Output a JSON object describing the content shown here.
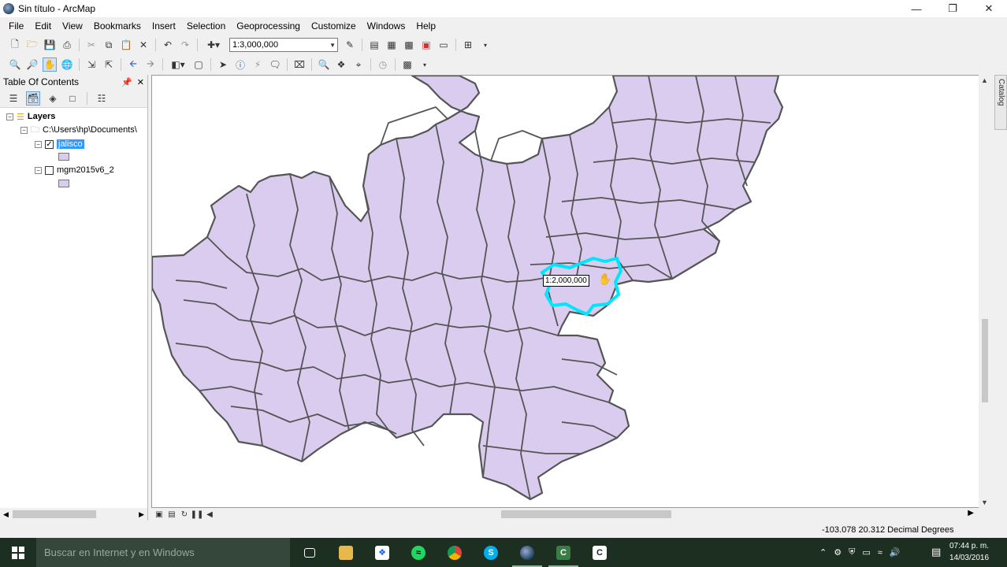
{
  "window": {
    "title": "Sin título - ArcMap",
    "controls": [
      "minimize",
      "restore",
      "close"
    ]
  },
  "menu": [
    "File",
    "Edit",
    "View",
    "Bookmarks",
    "Insert",
    "Selection",
    "Geoprocessing",
    "Customize",
    "Windows",
    "Help"
  ],
  "toolbar": {
    "scale_value": "1:3,000,000",
    "standard_icons": [
      "new-document-icon",
      "open-icon",
      "save-icon",
      "print-icon",
      "cut-icon",
      "copy-icon",
      "paste-icon",
      "delete-icon",
      "undo-icon",
      "redo-icon",
      "add-data-icon"
    ],
    "tools_icons": [
      "zoom-in-icon",
      "zoom-out-icon",
      "pan-icon",
      "full-extent-icon",
      "fixed-zoom-in-icon",
      "fixed-zoom-out-icon",
      "back-extent-icon",
      "forward-extent-icon",
      "select-features-icon",
      "clear-selection-icon",
      "select-elements-icon",
      "identify-icon",
      "hyperlink-icon",
      "html-popup-icon",
      "measure-icon",
      "find-icon",
      "find-route-icon",
      "go-to-xy-icon",
      "time-slider-icon",
      "create-viewer-icon"
    ]
  },
  "toc": {
    "title": "Table Of Contents",
    "root_label": "Layers",
    "folder_label": "C:\\Users\\hp\\Documents\\",
    "layers": [
      {
        "name": "jalisco",
        "checked": true,
        "selected": true,
        "fill": "#d9ccee"
      },
      {
        "name": "mgm2015v6_2",
        "checked": false,
        "selected": false,
        "fill": "#d9ccee"
      }
    ]
  },
  "map": {
    "fill_color": "#d9ccee",
    "border_color": "#555555",
    "highlight_color": "#00e5ff",
    "scale_tooltip": "1:2,000,000"
  },
  "catalog_tab": "Catalog",
  "status": {
    "coordinates": "-103.078  20.312 Decimal Degrees"
  },
  "taskbar": {
    "search_placeholder": "Buscar en Internet y en Windows",
    "apps": [
      "task-view",
      "file-explorer",
      "dropbox",
      "spotify",
      "chrome",
      "skype",
      "arcmap",
      "camtasia-recorder",
      "camtasia-studio"
    ],
    "time": "07:44 p. m.",
    "date": "14/03/2016"
  }
}
